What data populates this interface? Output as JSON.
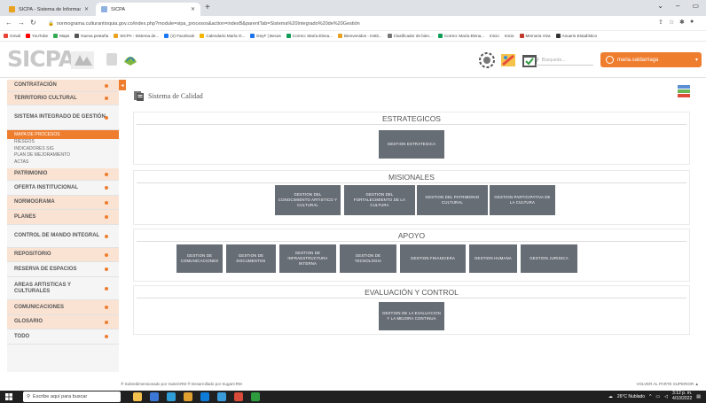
{
  "browser": {
    "tabs": [
      {
        "title": "SICPA - Sistema de Informació",
        "active": false
      },
      {
        "title": "SICPA",
        "active": true
      }
    ],
    "url": "normograma.culturantioquia.gov.co/index.php?module=sipa_procesos&action=indexB&parentTab=Sistema%20Integrado%20de%20Gestión",
    "bookmarks": [
      "Gmail",
      "YouTube",
      "Maps",
      "Nueva pestaña",
      "SICPA - Sistema de...",
      "(2) Facebook",
      "Calendario María O...",
      "DeyF | Becas",
      "Correo: María Elena...",
      "Bienvenidos - Instit...",
      "Clasificador de bien...",
      "Correo: María Elena...",
      "Inicio",
      "Inicio",
      "Memoria Viva",
      "Anuario Estadístico"
    ]
  },
  "header": {
    "logo": "SICPA",
    "search_placeholder": "Búsqueda...",
    "user": "maria.saldarriaga"
  },
  "sidebar": {
    "items": [
      {
        "label": "CONTRATACIÓN",
        "highlight": true
      },
      {
        "label": "TERRITORIO CULTURAL",
        "highlight": true
      },
      {
        "label": "SISTEMA INTEGRADO DE GESTIÓN",
        "highlight": false
      },
      {
        "label": "PATRIMONIO",
        "highlight": true
      },
      {
        "label": "OFERTA INSTITUCIONAL",
        "highlight": false
      },
      {
        "label": "NORMOGRAMA",
        "highlight": true
      },
      {
        "label": "PLANES",
        "highlight": true
      },
      {
        "label": "CONTROL DE MANDO INTEGRAL",
        "highlight": false
      },
      {
        "label": "REPOSITORIO",
        "highlight": true
      },
      {
        "label": "RESERVA DE ESPACIOS",
        "highlight": false
      },
      {
        "label": "AREAS ARTISTICAS Y CULTURALES",
        "highlight": false
      },
      {
        "label": "COMUNICACIONES",
        "highlight": true
      },
      {
        "label": "GLOSARIO",
        "highlight": true
      },
      {
        "label": "TODO",
        "highlight": false
      }
    ],
    "submenu": {
      "active": "MAPA DE PROCESOS",
      "items": [
        "RIESGOS",
        "INDICADORES SIG",
        "PLAN DE MEJORAMIENTO",
        "ACTAS"
      ]
    }
  },
  "main": {
    "title": "Sistema de Calidad",
    "sections": [
      {
        "title": "ESTRATEGICOS",
        "processes": [
          "GESTION ESTRATEGICA"
        ]
      },
      {
        "title": "MISIONALES",
        "processes": [
          "GESTION DEL CONOCIMIENTO ARTISTICO Y CULTURAL",
          "GESTION DEL FORTALECIMIENTO DE LA CULTURA",
          "GESTION DEL PATRIMONIO CULTURAL",
          "GESTION PARTICIPATIVA DE LA CULTURA"
        ]
      },
      {
        "title": "APOYO",
        "processes": [
          "GESTION DE COMUNICACIONES",
          "GESTION DE DOCUMENTOS",
          "GESTION DE INFRAESTRUCTURA INTERNA",
          "GESTION DE TECNOLOGIA",
          "GESTION FINANCIERA",
          "GESTION HUMANA",
          "GESTION JURIDICA"
        ]
      },
      {
        "title": "EVALUACIÓN Y CONTROL",
        "processes": [
          "GESTION DE LA EVALUACION Y LA MEJORA CONTINUA"
        ]
      }
    ]
  },
  "footer": {
    "left": "® Sobredimensionado por SuiteCRM   ® Desarrollado por SugarCRM",
    "right": "VOLVER AL PARTE SUPERIOR ▲"
  },
  "taskbar": {
    "search_placeholder": "Escribe aquí para buscar",
    "weather": "26°C Nublado",
    "time": "3:12 p. m.",
    "date": "4/10/2022"
  }
}
